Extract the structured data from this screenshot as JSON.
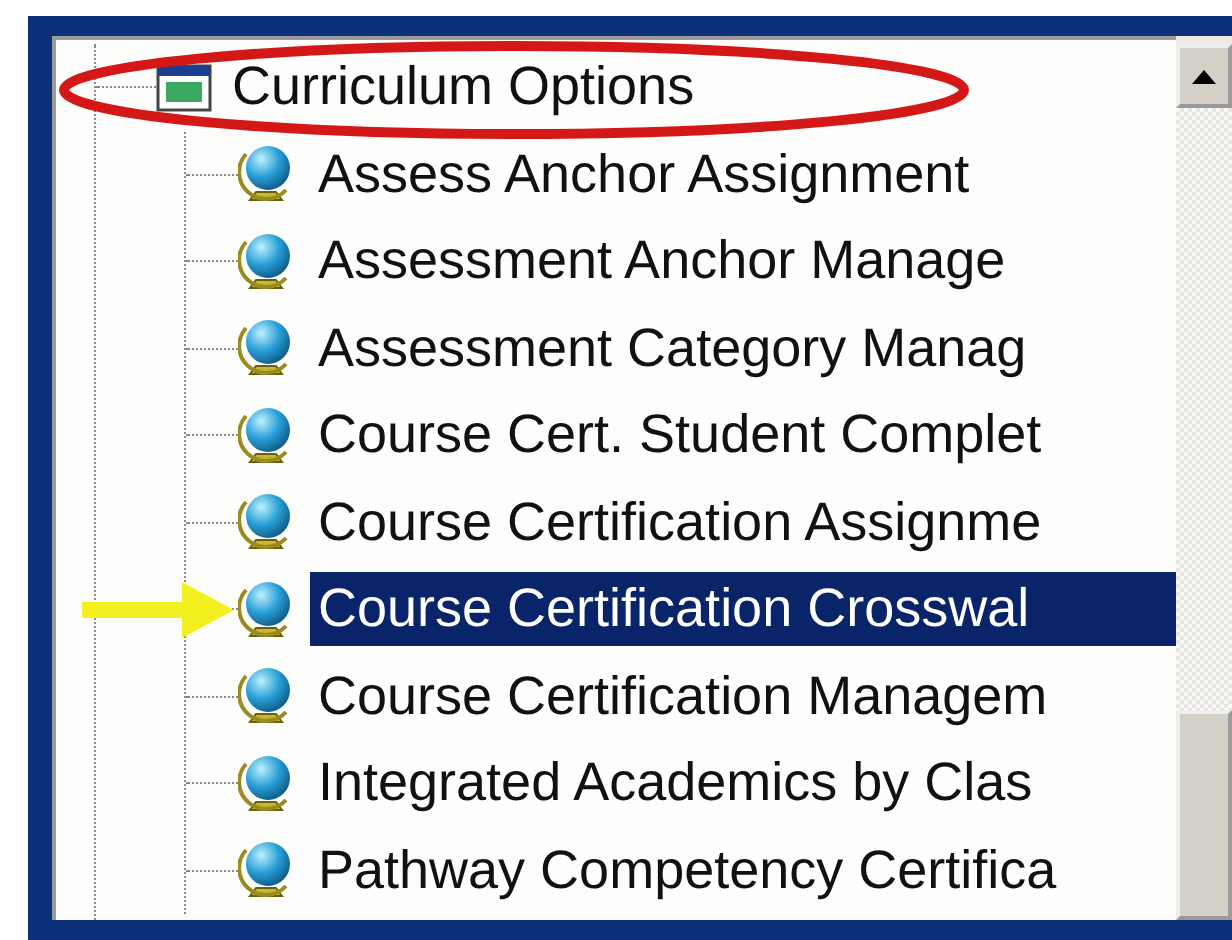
{
  "tree": {
    "items": [
      {
        "label": "Curriculum Options",
        "selected": false,
        "children": [
          {
            "label": "Assess Anchor Assignment",
            "selected": false
          },
          {
            "label": "Assessment Anchor Manage",
            "selected": false
          },
          {
            "label": "Assessment Category Manag",
            "selected": false
          },
          {
            "label": "Course Cert. Student Complet",
            "selected": false
          },
          {
            "label": "Course Certification Assignme",
            "selected": false
          },
          {
            "label": "Course Certification Crosswal",
            "selected": true
          },
          {
            "label": "Course Certification Managem",
            "selected": false
          },
          {
            "label": "Integrated Academics by Clas",
            "selected": false
          },
          {
            "label": "Pathway Competency Certifica",
            "selected": false
          }
        ]
      }
    ]
  }
}
